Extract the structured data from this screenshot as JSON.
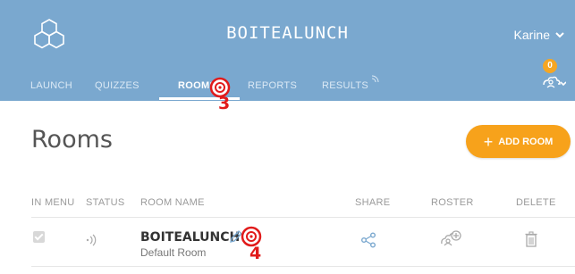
{
  "header": {
    "app_title": "BOITEALUNCH",
    "user_name": "Karine",
    "notification_count": "0"
  },
  "nav": {
    "items": [
      {
        "label": "LAUNCH"
      },
      {
        "label": "QUIZZES"
      },
      {
        "label": "ROOMS"
      },
      {
        "label": "REPORTS"
      },
      {
        "label": "RESULTS"
      }
    ],
    "active": "ROOMS"
  },
  "page": {
    "title": "Rooms",
    "add_button_label": "ADD ROOM"
  },
  "table": {
    "columns": [
      "IN MENU",
      "STATUS",
      "ROOM NAME",
      "SHARE",
      "ROSTER",
      "DELETE"
    ],
    "rows": [
      {
        "name": "BOITEALUNCH",
        "subtitle": "Default Room",
        "in_menu": true
      }
    ]
  },
  "annotations": {
    "step_3": "3",
    "step_4": "4"
  },
  "colors": {
    "header_bg": "#7aa8cf",
    "accent_orange": "#f7a21b",
    "marker_red": "#e11b1b"
  }
}
